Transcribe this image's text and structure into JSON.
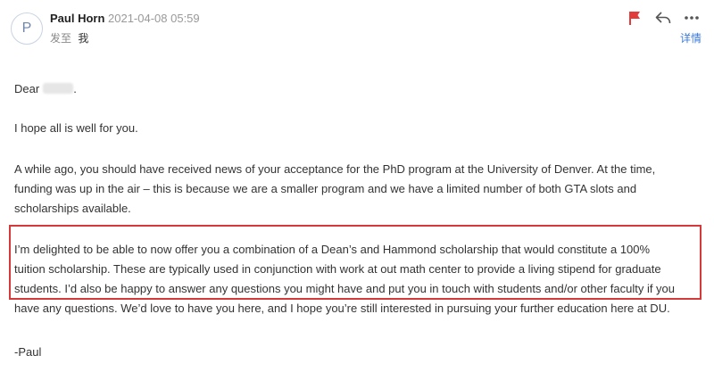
{
  "header": {
    "avatar_initial": "P",
    "sender_name": "Paul Horn",
    "timestamp": "2021-04-08 05:59",
    "sent_to_label": "发至",
    "sent_to_value": "我",
    "details_label": "详情",
    "flag_color": "#e23c3c"
  },
  "icons": {
    "flag": "flag-icon",
    "reply": "reply-icon",
    "more": "more-icon"
  },
  "body": {
    "salutation": "Dear",
    "greeting": "I hope all is well for you.",
    "para1": {
      "l1": "A while ago, you should have received news of your acceptance for the PhD program at the University of Denver.  At the time,",
      "l2": "funding was up in the air – this is because we are a smaller program and we have a limited number of both GTA slots and",
      "l3": "scholarships available."
    },
    "para2": {
      "l1": "I’m delighted to be able to now offer you a combination of a Dean’s and Hammond scholarship that would constitute a 100%",
      "l2": "tuition scholarship.  These are typically used in conjunction with work at out math center to provide a living stipend for graduate",
      "l3": "students.  I’d also be happy to answer any questions you might have and put you in touch with students and/or other faculty if you",
      "l4": "have any questions.  We’d love to have you here, and I hope you’re still interested in pursuing your further education here at DU."
    },
    "signature": "-Paul"
  },
  "colors": {
    "highlight_border": "#d43a3a",
    "link": "#3b7ad8"
  }
}
